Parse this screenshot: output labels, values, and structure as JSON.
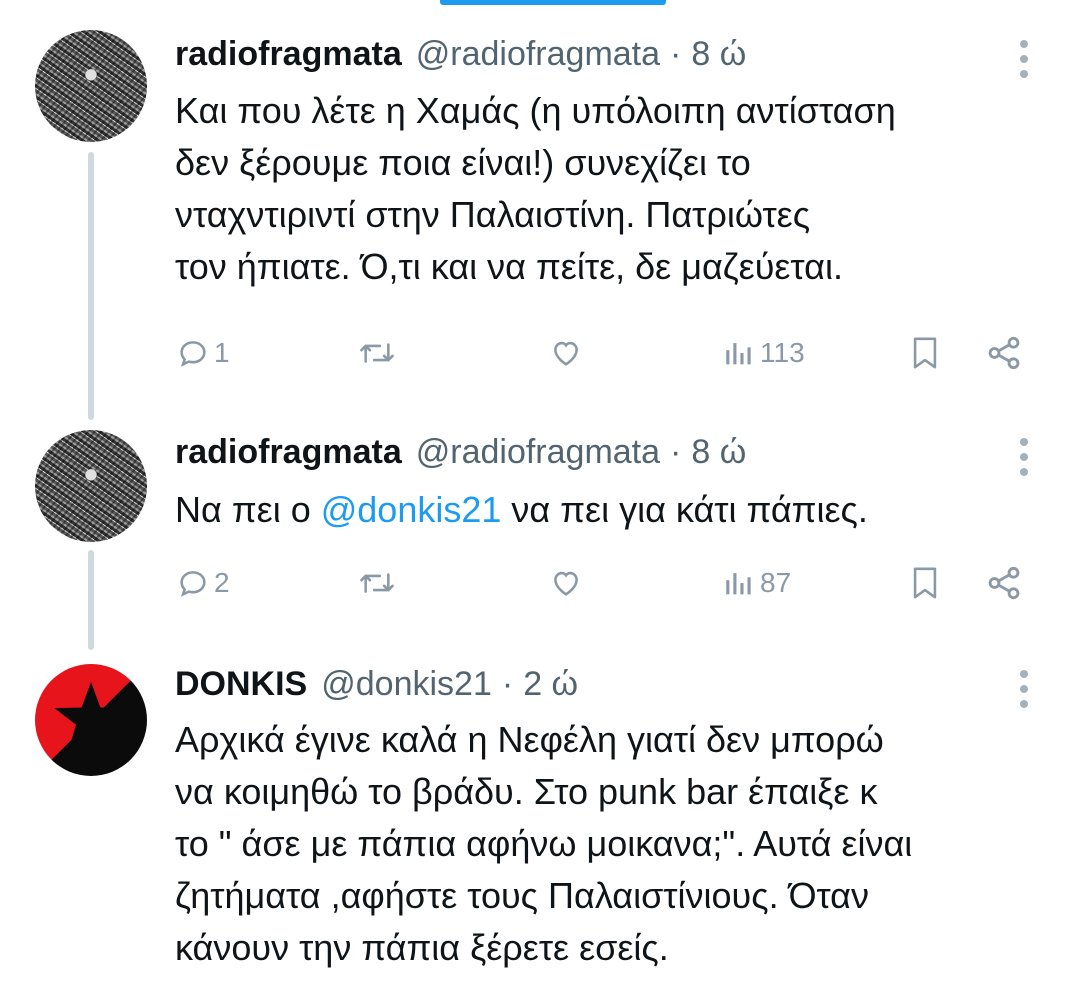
{
  "tweets": [
    {
      "name": "radiofragmata",
      "handle": "@radiofragmata",
      "separator": "·",
      "time": "8 ώ",
      "text": "Και που λέτε η Χαμάς (η υπόλοιπη αντίσταση\nδεν ξέρουμε ποια είναι!) συνεχίζει το\nνταχντιριντί στην Παλαιστίνη. Πατριώτες\nτον ήπιατε. Ό,τι και να πείτε, δε μαζεύεται.",
      "replies": "1",
      "retweets": "",
      "likes": "",
      "views": "113"
    },
    {
      "name": "radiofragmata",
      "handle": "@radiofragmata",
      "separator": "·",
      "time": "8 ώ",
      "text_before": "Να πει ο ",
      "mention": "@donkis21",
      "text_after": " να πει για κάτι πάπιες.",
      "replies": "2",
      "retweets": "",
      "likes": "",
      "views": "87"
    },
    {
      "name": "DONKIS",
      "handle": "@donkis21",
      "separator": "·",
      "time": "2 ώ",
      "text": "Αρχικά έγινε καλά η Νεφέλη γιατί δεν μπορώ\nνα κοιμηθώ το βράδυ. Στο punk bar έπαιξε κ\nτο \" άσε με πάπια αφήνω μοικανα;\". Αυτά είναι\nζητήματα ,αφήστε τους Παλαιστίνιους. Όταν\nκάνουν την πάπια ξέρετε εσείς."
    }
  ],
  "icons": {
    "reply": "reply-icon",
    "retweet": "retweet-icon",
    "like": "heart-icon",
    "views": "views-icon",
    "bookmark": "bookmark-icon",
    "share": "share-icon",
    "more": "more-icon"
  },
  "colors": {
    "accent": "#1d9bf0",
    "muted": "#536471",
    "thread_line": "#cfd9de"
  }
}
